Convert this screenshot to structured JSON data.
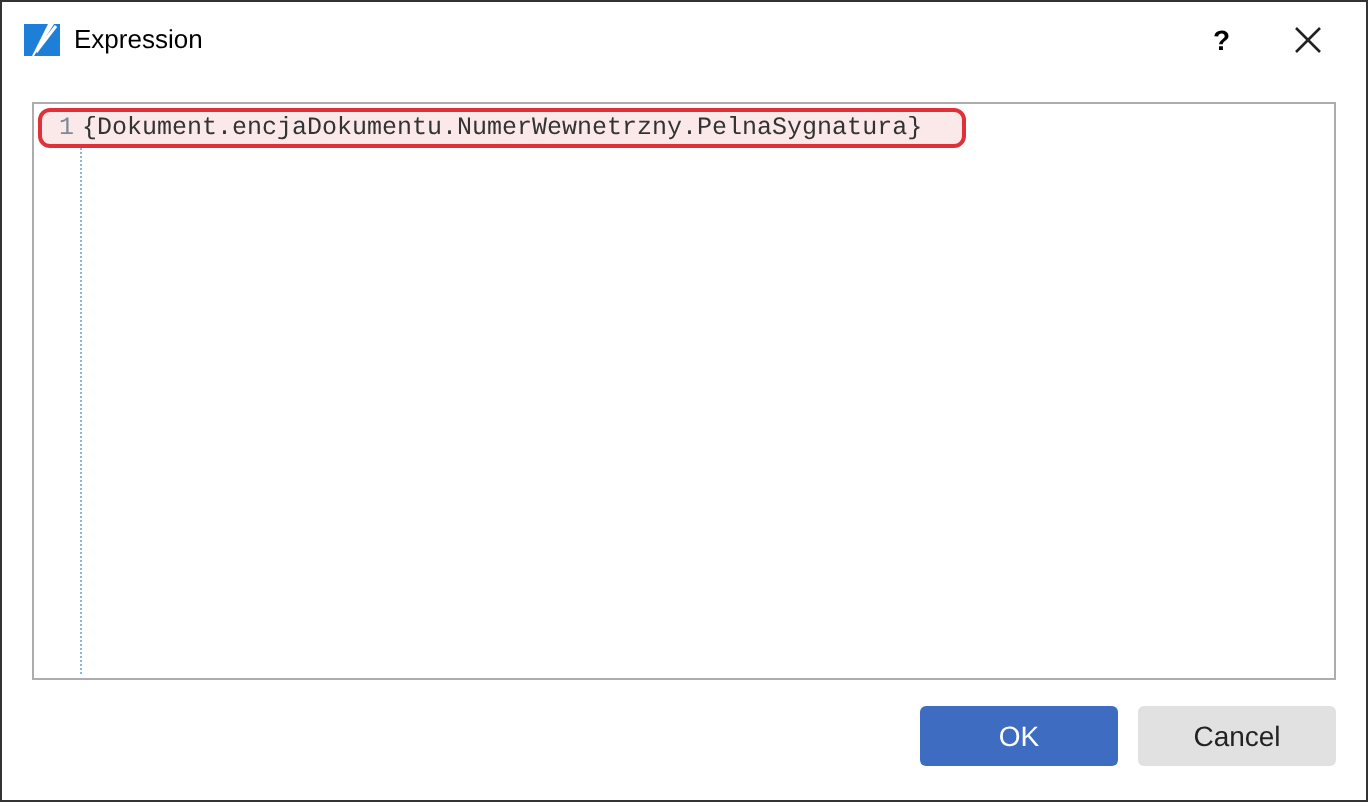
{
  "window": {
    "title": "Expression",
    "help": "?"
  },
  "editor": {
    "lines": [
      {
        "number": "1",
        "text": "{Dokument.encjaDokumentu.NumerWewnetrzny.PelnaSygnatura}",
        "highlighted": true
      }
    ]
  },
  "buttons": [
    {
      "label": "OK",
      "kind": "primary"
    },
    {
      "label": "Cancel",
      "kind": "secondary"
    }
  ]
}
